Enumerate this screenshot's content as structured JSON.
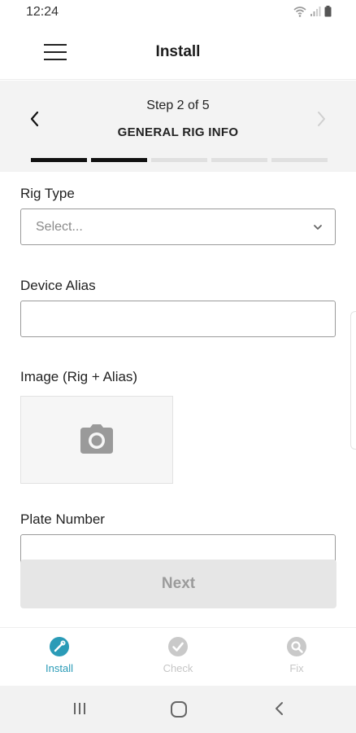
{
  "status_bar": {
    "time": "12:24",
    "icons": [
      "wifi-icon",
      "signal-icon",
      "battery-icon"
    ]
  },
  "header": {
    "title": "Install",
    "menu_icon": "hamburger-menu-icon"
  },
  "stepper": {
    "step_text": "Step 2 of 5",
    "step_name": "GENERAL RIG INFO",
    "total_steps": 5,
    "completed_steps": 2
  },
  "form": {
    "rig_type": {
      "label": "Rig Type",
      "placeholder": "Select..."
    },
    "device_alias": {
      "label": "Device Alias",
      "value": ""
    },
    "image": {
      "label": "Image (Rig + Alias)",
      "icon": "camera-icon"
    },
    "plate_number": {
      "label": "Plate Number",
      "value": ""
    }
  },
  "next_button": {
    "label": "Next",
    "enabled": false
  },
  "tabs": [
    {
      "label": "Install",
      "icon": "install-icon",
      "active": true
    },
    {
      "label": "Check",
      "icon": "check-icon",
      "active": false
    },
    {
      "label": "Fix",
      "icon": "fix-icon",
      "active": false
    }
  ],
  "colors": {
    "accent": "#2a9bb7",
    "disabled": "#e6e6e6",
    "inactive_tab": "#c6c6c6"
  }
}
